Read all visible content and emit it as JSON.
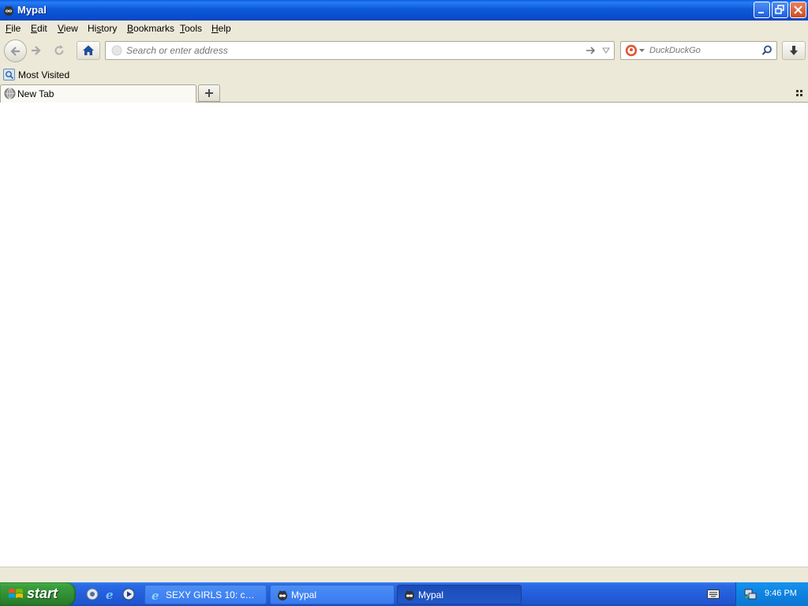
{
  "window": {
    "title": "Mypal"
  },
  "menu": [
    {
      "label": "File",
      "accel": "F"
    },
    {
      "label": "Edit",
      "accel": "E"
    },
    {
      "label": "View",
      "accel": "V"
    },
    {
      "label": "History",
      "accel": "s"
    },
    {
      "label": "Bookmarks",
      "accel": "B"
    },
    {
      "label": "Tools",
      "accel": "T"
    },
    {
      "label": "Help",
      "accel": "H"
    }
  ],
  "urlbar": {
    "placeholder": "Search or enter address",
    "value": ""
  },
  "search": {
    "placeholder": "DuckDuckGo",
    "engine": "DuckDuckGo"
  },
  "bookmarks": [
    {
      "label": "Most Visited"
    }
  ],
  "tabs": [
    {
      "label": "New Tab",
      "active": true
    }
  ],
  "taskbar": {
    "start_label": "start",
    "items": [
      {
        "label": "SEXY GIRLS 10: collec...",
        "active": false
      },
      {
        "label": "Mypal",
        "active": false
      },
      {
        "label": "Mypal",
        "active": true
      }
    ],
    "clock": "9:46 PM"
  },
  "colors": {
    "titlebar": "#0a5ad8",
    "chrome": "#ece9d8",
    "taskbar": "#245edb",
    "start": "#3a9c3d",
    "home_icon": "#1d4f9c"
  }
}
